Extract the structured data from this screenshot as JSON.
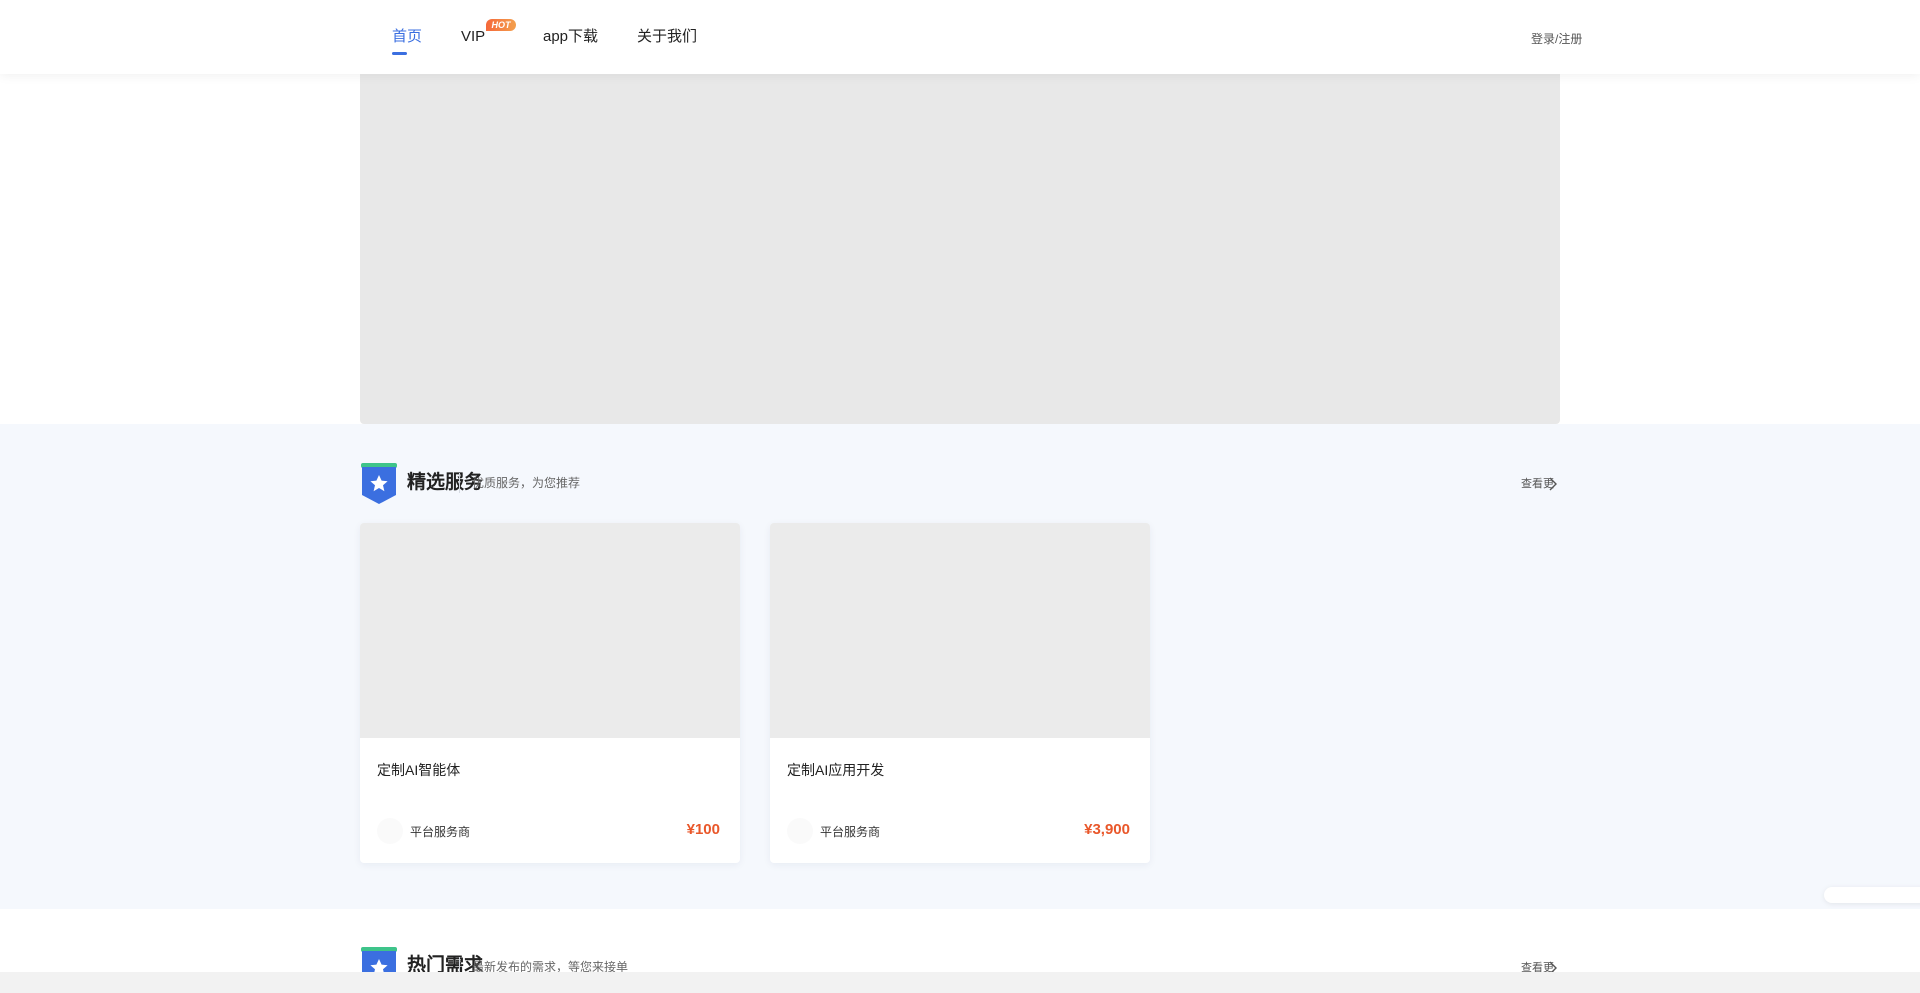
{
  "nav": {
    "items": [
      {
        "label": "首页",
        "active": true
      },
      {
        "label": "VIP",
        "badge": "HOT"
      },
      {
        "label": "app下载"
      },
      {
        "label": "关于我们"
      }
    ],
    "login_label": "登录/注册"
  },
  "sections": [
    {
      "title": "精选服务",
      "subtitle": "优质服务，为您推荐",
      "more_label": "查看更",
      "cards": [
        {
          "title": "定制AI智能体",
          "seller": "平台服务商",
          "price": "¥100"
        },
        {
          "title": "定制AI应用开发",
          "seller": "平台服务商",
          "price": "¥3,900"
        }
      ]
    },
    {
      "title": "热门需求",
      "subtitle": "最新发布的需求，等您来接单",
      "more_label": "查看更"
    }
  ],
  "colors": {
    "accent": "#3b6fe0",
    "price": "#e9572a",
    "section_bg": "#f5f8fd",
    "hot_badge": "#f5683a"
  },
  "icons": {
    "section_icon": "star-badge-icon",
    "more_icon": "chevron-right-icon"
  }
}
